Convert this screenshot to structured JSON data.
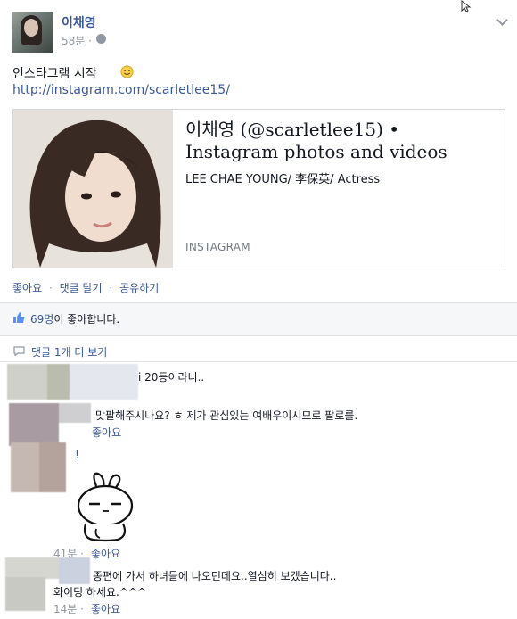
{
  "post": {
    "author": "이채영",
    "time": "58분 ·",
    "text": "인스타그램 시작",
    "link": "http://instagram.com/scarletlee15/"
  },
  "card": {
    "title": "이채영 (@scarletlee15) • Instagram photos and videos",
    "description": "LEE CHAE YOUNG/ 李保英/ Actress",
    "source": "INSTAGRAM"
  },
  "actions": {
    "like": "좋아요",
    "sep1": "·",
    "comment": "댓글 달기",
    "sep2": "·",
    "share": "공유하기"
  },
  "likes": {
    "count_text": "69명",
    "suffix": "이 좋아합니다."
  },
  "view_more": "댓글 1개 더 보기",
  "comments": [
    {
      "text": "i 20등이라니.."
    },
    {
      "text": "맞팔해주시나요? ㅎ 제가 관심있는 여배우이시므로 팔로를.",
      "like": "좋아요"
    },
    {
      "text": "!",
      "time": "41분 ·",
      "like": "좋아요"
    },
    {
      "text": "종편에 가서 하녀들에 나오던데요..열심히 보겠습니다..",
      "text2": "화이팅 하세요.^^^",
      "time": "14분 ·",
      "like": "좋아요"
    }
  ],
  "colors": {
    "link": "#3b5998",
    "grey": "#9197a3",
    "like_bar_bg": "#f6f7f9",
    "border": "#d3d6db"
  }
}
